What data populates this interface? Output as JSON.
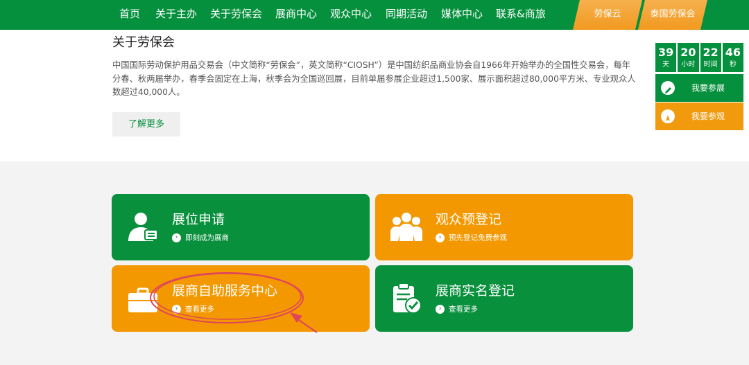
{
  "nav": {
    "items": [
      "首页",
      "关于主办",
      "关于劳保会",
      "展商中心",
      "观众中心",
      "同期活动",
      "媒体中心",
      "联系&商旅"
    ],
    "tabs": [
      "劳保云",
      "泰国劳保会"
    ]
  },
  "about": {
    "title": "关于劳保会",
    "text": "中国国际劳动保护用品交易会（中文简称“劳保会”，英文简称“CIOSH”）是中国纺织品商业协会自1966年开始举办的全国性交易会，每年分春、秋两届举办，春季会固定在上海，秋季会为全国巡回展，目前单届参展企业超过1,500家、展示面积超过80,000平方米、专业观众人数超过40,000人。",
    "more_label": "了解更多"
  },
  "countdown": [
    {
      "num": "39",
      "unit": "天"
    },
    {
      "num": "20",
      "unit": "小时"
    },
    {
      "num": "22",
      "unit": "时间"
    },
    {
      "num": "46",
      "unit": "秒"
    }
  ],
  "side": {
    "exhibit_label": "我要参展",
    "visit_label": "我要参观"
  },
  "cards": [
    {
      "title": "展位申请",
      "sub": "即刻成为展商"
    },
    {
      "title": "观众预登记",
      "sub": "预先登记免费参观"
    },
    {
      "title": "展商自助服务中心",
      "sub": "查看更多"
    },
    {
      "title": "展商实名登记",
      "sub": "查看更多"
    }
  ],
  "colors": {
    "green": "#05903d",
    "orange": "#f39800",
    "annotation": "#e0455a"
  }
}
